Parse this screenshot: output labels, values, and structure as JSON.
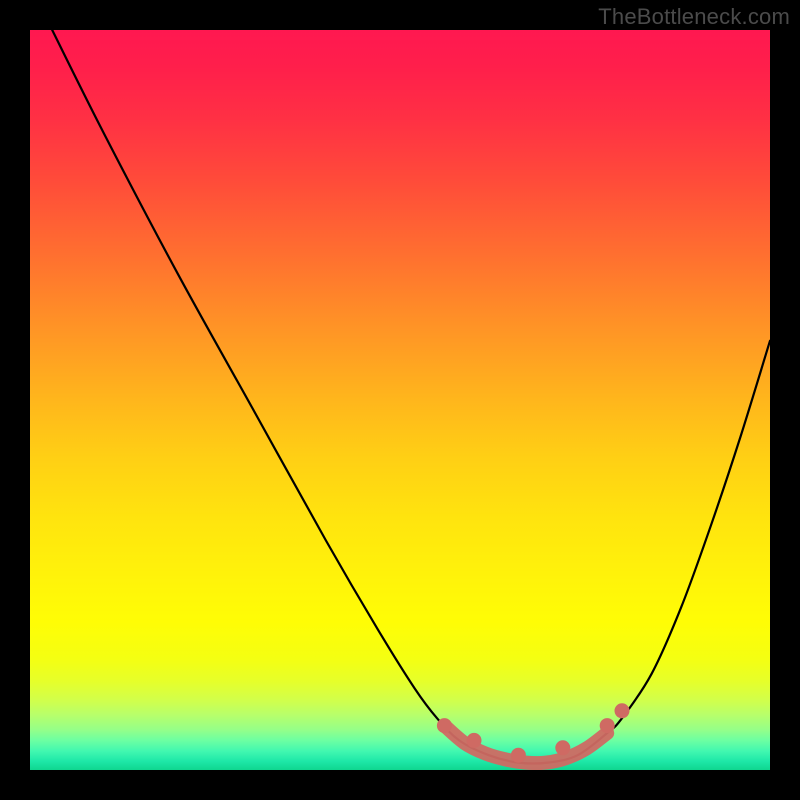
{
  "watermark": "TheBottleneck.com",
  "colors": {
    "frame": "#000000",
    "curve": "#000000",
    "marker": "#cf6a63",
    "marker_stroke": "#cf6a63",
    "watermark": "#4b4b4b"
  },
  "gradient_stops": [
    {
      "offset": 0.0,
      "color": "#ff1850"
    },
    {
      "offset": 0.05,
      "color": "#ff1f4b"
    },
    {
      "offset": 0.12,
      "color": "#ff3044"
    },
    {
      "offset": 0.2,
      "color": "#ff4a3a"
    },
    {
      "offset": 0.3,
      "color": "#ff6e30"
    },
    {
      "offset": 0.4,
      "color": "#ff9326"
    },
    {
      "offset": 0.5,
      "color": "#ffb61c"
    },
    {
      "offset": 0.58,
      "color": "#ffd014"
    },
    {
      "offset": 0.66,
      "color": "#ffe40e"
    },
    {
      "offset": 0.74,
      "color": "#fff30a"
    },
    {
      "offset": 0.8,
      "color": "#fffd05"
    },
    {
      "offset": 0.85,
      "color": "#f4ff12"
    },
    {
      "offset": 0.88,
      "color": "#e6ff2a"
    },
    {
      "offset": 0.905,
      "color": "#d2ff4a"
    },
    {
      "offset": 0.925,
      "color": "#b8ff6a"
    },
    {
      "offset": 0.945,
      "color": "#96ff88"
    },
    {
      "offset": 0.96,
      "color": "#6cffa2"
    },
    {
      "offset": 0.975,
      "color": "#40f7b0"
    },
    {
      "offset": 0.988,
      "color": "#1ee8a8"
    },
    {
      "offset": 1.0,
      "color": "#0fd68f"
    }
  ],
  "chart_data": {
    "type": "line",
    "title": "",
    "xlabel": "",
    "ylabel": "",
    "xlim": [
      0,
      100
    ],
    "ylim": [
      0,
      100
    ],
    "series": [
      {
        "name": "bottleneck-curve",
        "x": [
          3,
          10,
          20,
          30,
          40,
          47,
          52,
          55,
          58,
          62,
          66,
          70,
          74,
          78,
          80,
          84,
          88,
          92,
          96,
          100
        ],
        "y": [
          100,
          86,
          67,
          49,
          31,
          19,
          11,
          7,
          4,
          2,
          1,
          1,
          2,
          5,
          7,
          13,
          22,
          33,
          45,
          58
        ]
      }
    ],
    "markers": [
      {
        "name": "flat-region-left-end",
        "x": 56,
        "y": 6
      },
      {
        "name": "flat-region-point",
        "x": 60,
        "y": 4
      },
      {
        "name": "flat-region-min",
        "x": 66,
        "y": 2
      },
      {
        "name": "flat-region-point2",
        "x": 72,
        "y": 3
      },
      {
        "name": "flat-region-right-end",
        "x": 78,
        "y": 6
      },
      {
        "name": "right-knee-marker",
        "x": 80,
        "y": 8
      }
    ],
    "flat_region_stroke": {
      "from_x": 56,
      "to_x": 78
    }
  }
}
